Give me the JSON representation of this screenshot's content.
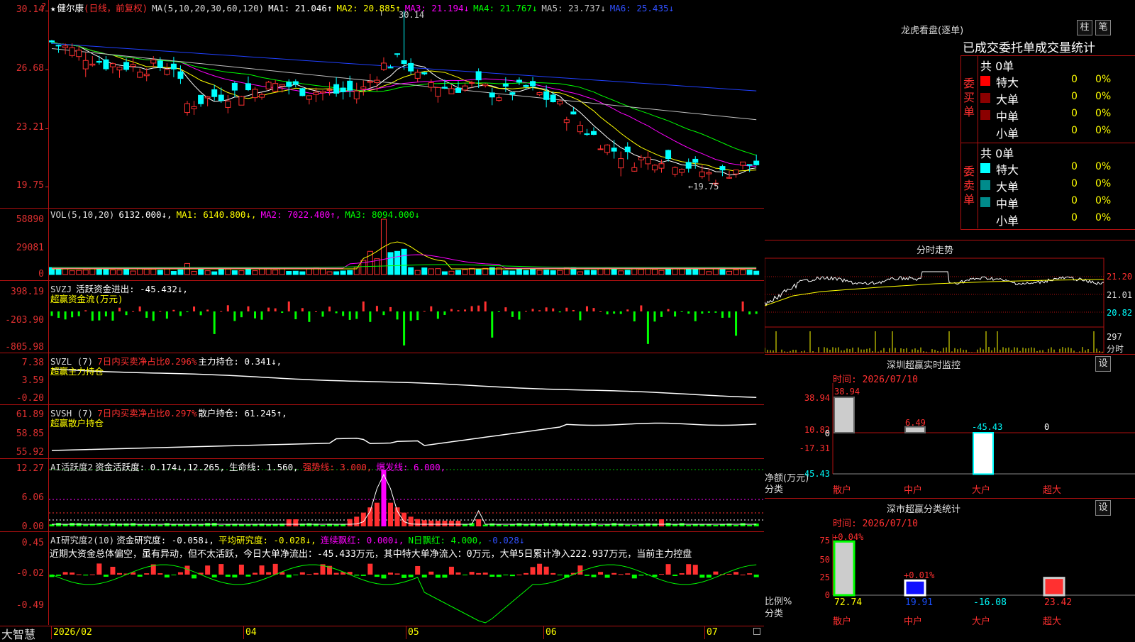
{
  "app": {
    "brand": "大智慧",
    "timeframe_corner": "?"
  },
  "main": {
    "title_star": "★",
    "stock_name": "健尔康",
    "period": "(日线，前复权)",
    "ma_def": "MA(5,10,20,30,60,120)",
    "ma1": "MA1: 21.046↑",
    "ma2": "MA2: 20.885↑",
    "ma3": "MA3: 21.194↓",
    "ma4": "MA4: 21.767↓",
    "ma5": "MA5: 23.737↓",
    "ma6": "MA6: 25.435↓",
    "yticks": [
      "30.14",
      "26.68",
      "23.21",
      "19.75"
    ],
    "high_label": "30.14",
    "low_label": "←19.75",
    "colors": {
      "ma1": "#ffffff",
      "ma2": "#ffff00",
      "ma3": "#ff00ff",
      "ma4": "#00ff00",
      "ma5": "#c0c0c0",
      "ma6": "#2040ff"
    }
  },
  "vol": {
    "def": "VOL(5,10,20)",
    "value": "6132.000↓,",
    "ma1": "MA1: 6140.800↓,",
    "ma2": "MA2: 7022.400↑,",
    "ma3": "MA3: 8094.000↓",
    "yticks": [
      "58890",
      "29081",
      "0"
    ]
  },
  "svzj": {
    "def": "SVZJ",
    "title": "活跃资金进出: -45.432↓,",
    "sub": "超赢资金流(万元)",
    "yticks": [
      "398.19",
      "-203.90",
      "-805.98"
    ]
  },
  "svzl": {
    "def": "SVZL (7)",
    "ratio": "7日内买卖净占比0.296%",
    "title": "主力持仓: 0.341↓,",
    "sub": "超赢主力持仓",
    "yticks": [
      "7.38",
      "3.59",
      "-0.20"
    ]
  },
  "svsh": {
    "def": "SVSH (7)",
    "ratio": "7日内买卖净占比0.297%",
    "title": "散户持仓: 61.245↑,",
    "sub": "超赢散户持仓",
    "yticks": [
      "61.89",
      "58.85",
      "55.92"
    ]
  },
  "ai1": {
    "def": "AI活跃度2",
    "title": "资金活跃度: 0.174↓,",
    "v2": "12.265,",
    "life": "生命线: 1.560,",
    "strong": "强势线: 3.000,",
    "burst": "爆发线: 6.000,",
    "yticks": [
      "12.27",
      "6.06",
      "0.00"
    ]
  },
  "ai2": {
    "def": "AI研究度2(10)",
    "title": "资金研究度: -0.058↓,",
    "avg": "平均研究度: -0.028↓,",
    "cont": "连续飘红: 0.000↓,",
    "nday": "N日飘红: 4.000,",
    "last": "-0.028↓",
    "comment": "近期大资金总体偏空，虽有异动，但不太活跃，今日大单净流出：-45.433万元，其中特大单净流入：0万元，大单5日累计净入222.937万元，当前主力控盘",
    "yticks": [
      "0.45",
      "-0.02",
      "-0.49"
    ]
  },
  "xaxis": {
    "labels": [
      "2026/02",
      "04",
      "05",
      "06",
      "07"
    ]
  },
  "longhu": {
    "title": "龙虎看盘(逐单)",
    "btn_bar": "柱",
    "btn_pen": "笔",
    "table_title": "已成交委托单成交量统计",
    "buy_side": "委买单",
    "sell_side": "委卖单",
    "buy_total": "共 0单",
    "sell_total": "共 0单",
    "rows": [
      {
        "label": "特大",
        "count": "0",
        "pct": "0%"
      },
      {
        "label": "大单",
        "count": "0",
        "pct": "0%"
      },
      {
        "label": "中单",
        "count": "0",
        "pct": "0%"
      },
      {
        "label": "小单",
        "count": "0",
        "pct": "0%"
      }
    ]
  },
  "intraday": {
    "title": "分时走势",
    "prices": [
      "21.20",
      "21.01",
      "20.82"
    ],
    "vol": "297",
    "unit": "分时"
  },
  "sz_monitor": {
    "title": "深圳超赢实时监控",
    "btn": "设",
    "time": "时间: 2026/07/10",
    "yticks": [
      "38.94",
      "10.82",
      "0",
      "-17.31",
      "-45.43"
    ],
    "ylabel": "净额(万元)",
    "xlabel": "分类",
    "cats": [
      "散户",
      "中户",
      "大户",
      "超大"
    ],
    "vals": [
      "38.94",
      "6.49",
      "-45.43",
      "0"
    ]
  },
  "sz_class": {
    "title": "深市超赢分类统计",
    "btn": "设",
    "time": "时间: 2026/07/10",
    "yticks": [
      "75",
      "50",
      "25",
      "0"
    ],
    "ylabel": "比例%",
    "xlabel": "分类",
    "cats": [
      "散户",
      "中户",
      "大户",
      "超大"
    ],
    "top": [
      "+0.04%",
      "+0.01%"
    ],
    "vals": [
      "72.74",
      "19.91",
      "-16.08",
      "23.42"
    ]
  }
}
